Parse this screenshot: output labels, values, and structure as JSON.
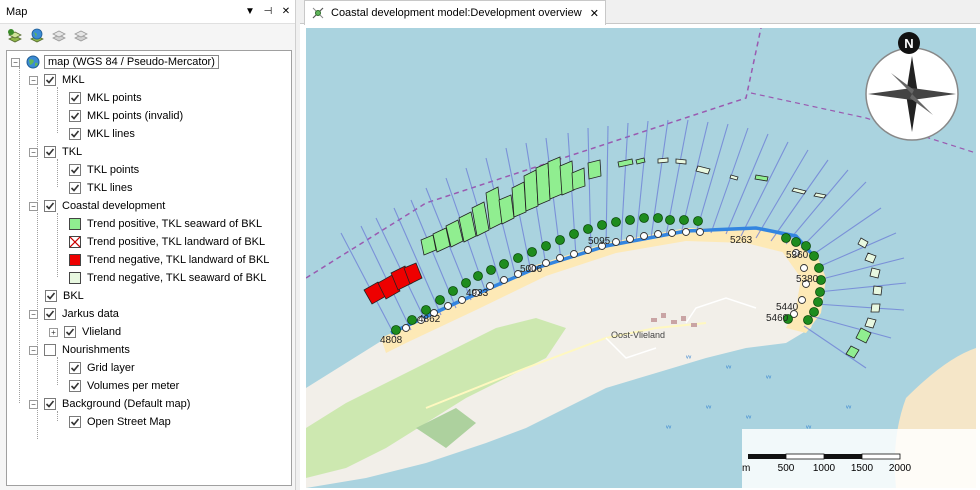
{
  "map_panel": {
    "title": "Map",
    "controls": {
      "dropdown": "▼",
      "pin": "⊣",
      "close": "✕"
    },
    "tree": {
      "root": {
        "label": "map (WGS 84 / Pseudo-Mercator)"
      },
      "mkl": {
        "label": "MKL",
        "children": [
          "MKL points",
          "MKL points (invalid)",
          "MKL lines"
        ]
      },
      "tkl": {
        "label": "TKL",
        "children": [
          "TKL points",
          "TKL lines"
        ]
      },
      "coastal": {
        "label": "Coastal development",
        "legend": [
          {
            "label": "Trend positive, TKL seaward of BKL",
            "color": "#90ee90"
          },
          {
            "label": "Trend positive, TKL landward of BKL",
            "color": "#ffffff",
            "cross": "#cc0000"
          },
          {
            "label": "Trend negative, TKL landward of BKL",
            "color": "#ee0000"
          },
          {
            "label": "Trend negative, TKL seaward of BKL",
            "color": "#e8f8e0"
          }
        ]
      },
      "bkl": {
        "label": "BKL"
      },
      "jarkus": {
        "label": "Jarkus data",
        "children": [
          "Vlieland"
        ]
      },
      "nourishments": {
        "label": "Nourishments",
        "children": [
          "Grid layer",
          "Volumes per meter"
        ]
      },
      "background": {
        "label": "Background (Default map)",
        "children": [
          "Open Street Map"
        ]
      }
    }
  },
  "document": {
    "tab_title": "Coastal development model:Development overview",
    "tab_close": "✕",
    "map": {
      "transect_labels": [
        "4808",
        "4862",
        "4933",
        "5006",
        "5095",
        "5263",
        "5360",
        "5380",
        "5440",
        "5460"
      ],
      "town_label": "Oost-Vlieland",
      "compass_letter": "N",
      "scale": {
        "unit": "m",
        "ticks": [
          "500",
          "1000",
          "1500",
          "2000"
        ]
      },
      "colors": {
        "sea": "#aad3df",
        "land": "#f2efe9",
        "beach": "#fde9b6",
        "green": "#cde8b0",
        "dots": "#1e8c1e",
        "bkl": "#3385e0",
        "transect": "#6b7bd6"
      }
    }
  }
}
